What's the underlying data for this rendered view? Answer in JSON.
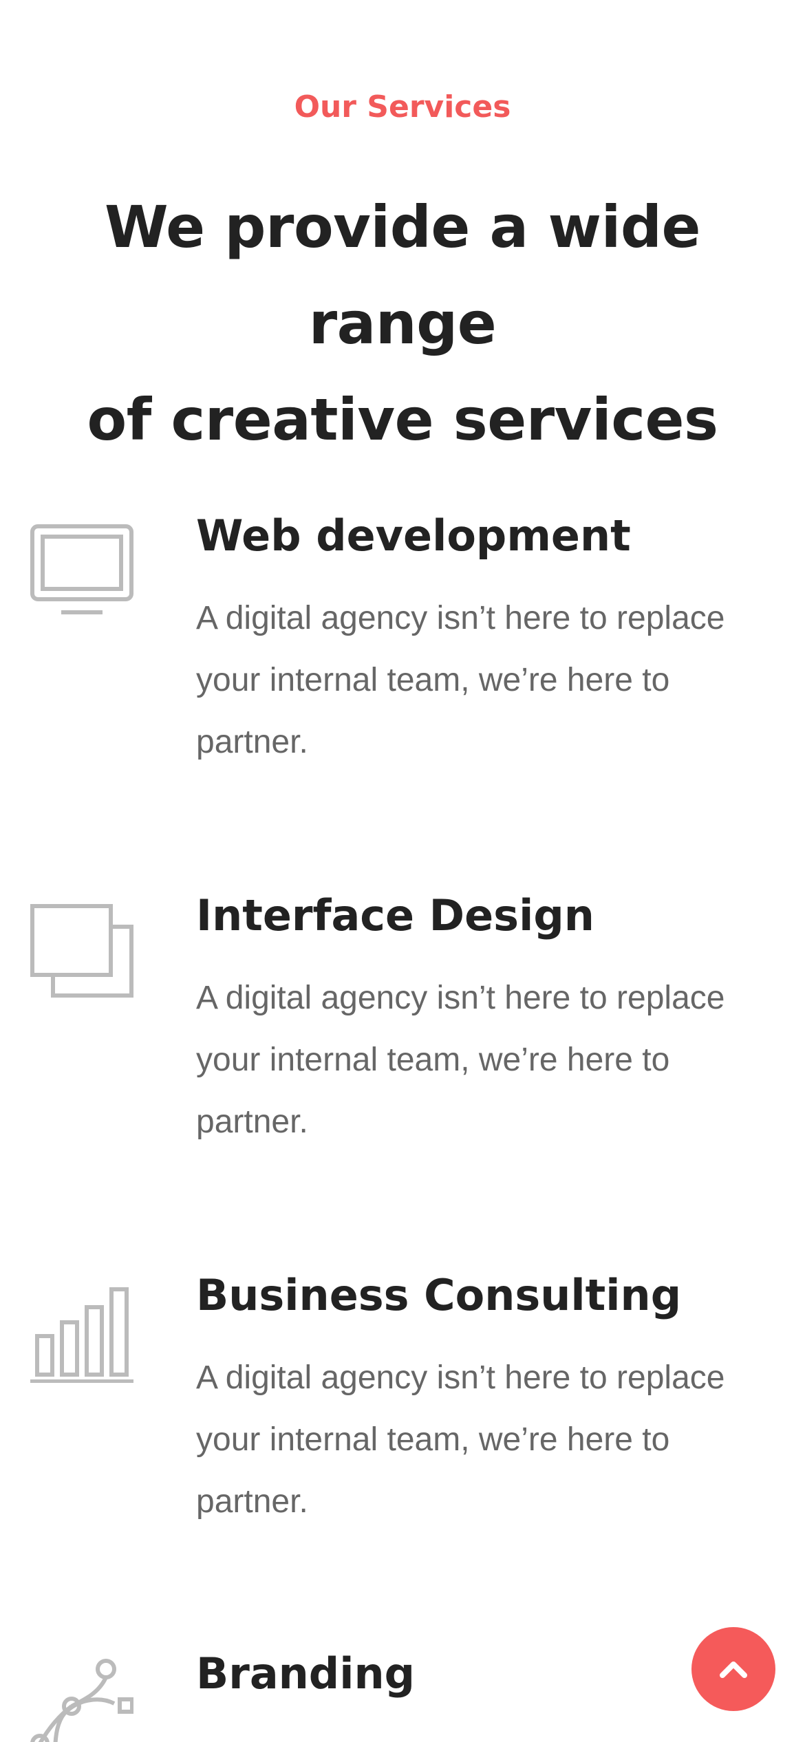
{
  "section": {
    "eyebrow": "Our Services",
    "headline_line1": "We provide a wide range",
    "headline_line2": "of creative services"
  },
  "services": [
    {
      "icon": "monitor-icon",
      "title": "Web development",
      "description_line1": "A digital agency isn’t here to replace",
      "description_line2": "your internal team, we’re here to",
      "description_line3": "partner."
    },
    {
      "icon": "layers-icon",
      "title": "Interface Design",
      "description_line1": "A digital agency isn’t here to replace",
      "description_line2": "your internal team, we’re here to",
      "description_line3": "partner."
    },
    {
      "icon": "bar-chart-icon",
      "title": "Business Consulting",
      "description_line1": "A digital agency isn’t here to replace",
      "description_line2": "your internal team, we’re here to",
      "description_line3": "partner."
    },
    {
      "icon": "bezier-pen-icon",
      "title": "Branding"
    }
  ],
  "scroll_top": {
    "icon": "chevron-up-icon"
  },
  "colors": {
    "accent": "#f25a5a",
    "heading": "#222222",
    "body_text": "#666666",
    "icon_gray": "#bbbbbb"
  }
}
